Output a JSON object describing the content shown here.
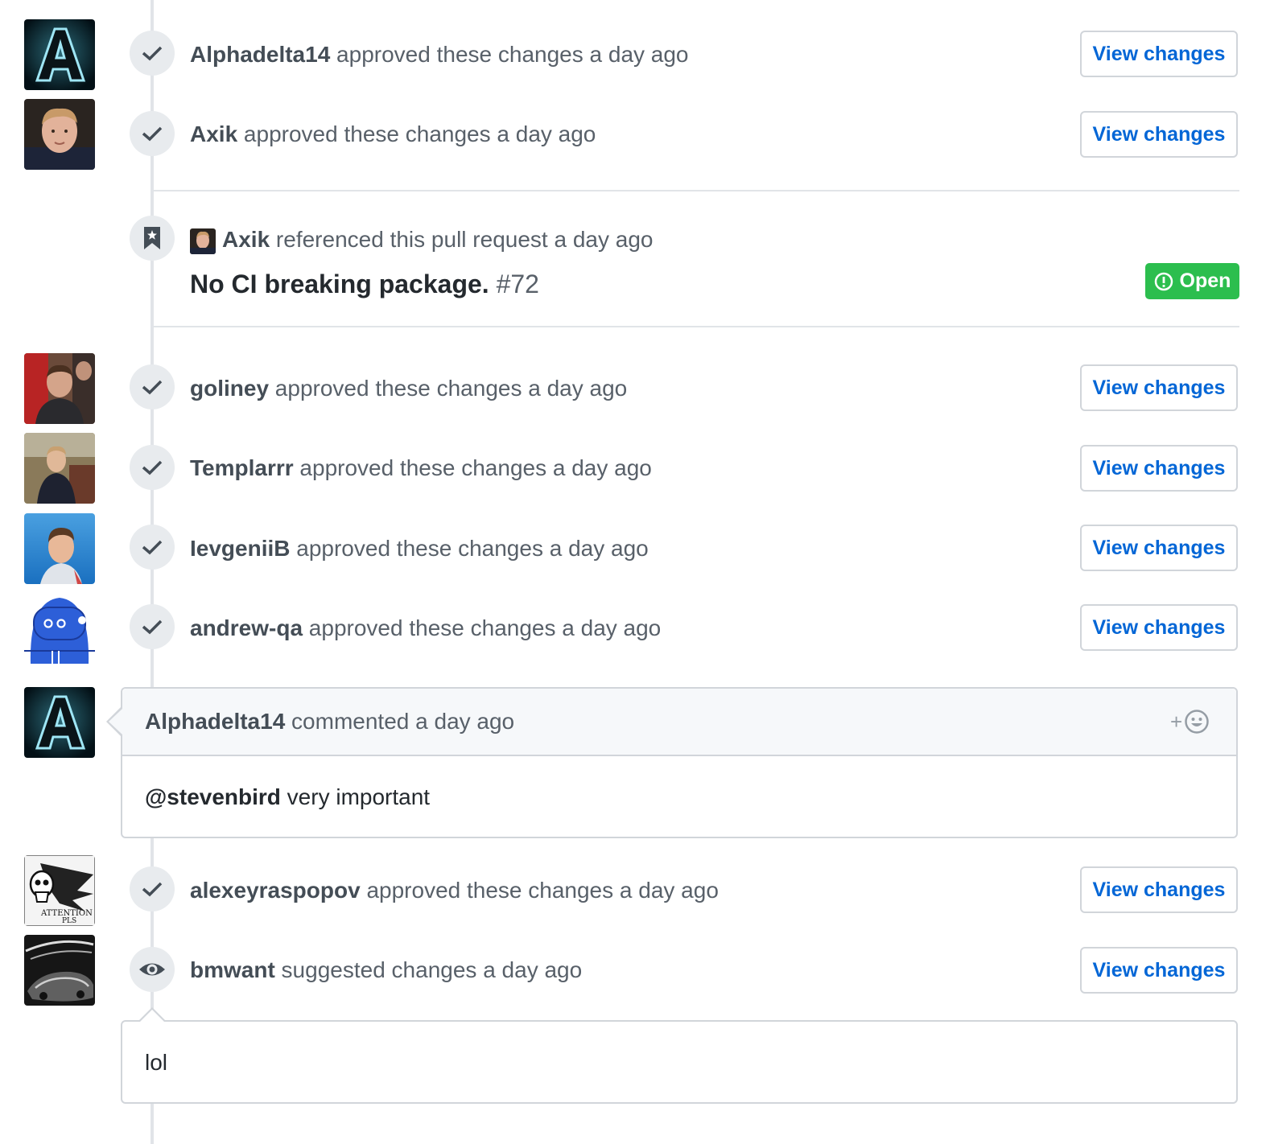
{
  "reviews_top": [
    {
      "author": "Alphadelta14",
      "action": " approved these changes",
      "time": " a day ago",
      "button": "View changes"
    },
    {
      "author": "Axik",
      "action": " approved these changes",
      "time": " a day ago",
      "button": "View changes"
    }
  ],
  "reference": {
    "author": "Axik",
    "action": " referenced this pull request",
    "time": " a day ago",
    "pr_title": "No CI breaking package.",
    "pr_number": " #72",
    "state": "Open"
  },
  "reviews_mid": [
    {
      "author": "goliney",
      "action": " approved these changes",
      "time": " a day ago",
      "button": "View changes"
    },
    {
      "author": "Templarrr",
      "action": " approved these changes",
      "time": " a day ago",
      "button": "View changes"
    },
    {
      "author": "IevgeniiB",
      "action": " approved these changes",
      "time": " a day ago",
      "button": "View changes"
    },
    {
      "author": "andrew-qa",
      "action": " approved these changes",
      "time": " a day ago",
      "button": "View changes"
    }
  ],
  "comment": {
    "author": "Alphadelta14",
    "action": " commented",
    "time": " a day ago",
    "mention": "@stevenbird",
    "body": " very important",
    "reaction_plus": "+"
  },
  "reviews_bottom": [
    {
      "author": "alexeyraspopov",
      "action": " approved these changes",
      "time": " a day ago",
      "button": "View changes"
    },
    {
      "author": "bmwant",
      "action": " suggested changes",
      "time": " a day ago",
      "button": "View changes"
    }
  ],
  "suggestion_body": "lol",
  "avatar_text": {
    "attention": "ATTENTION",
    "pls": "PLS"
  },
  "colors": {
    "link": "#0366d6",
    "open_badge": "#2cbe4e",
    "muted": "#586069",
    "author": "#444d56",
    "border": "#d1d5da",
    "timeline": "#e1e4e8"
  }
}
